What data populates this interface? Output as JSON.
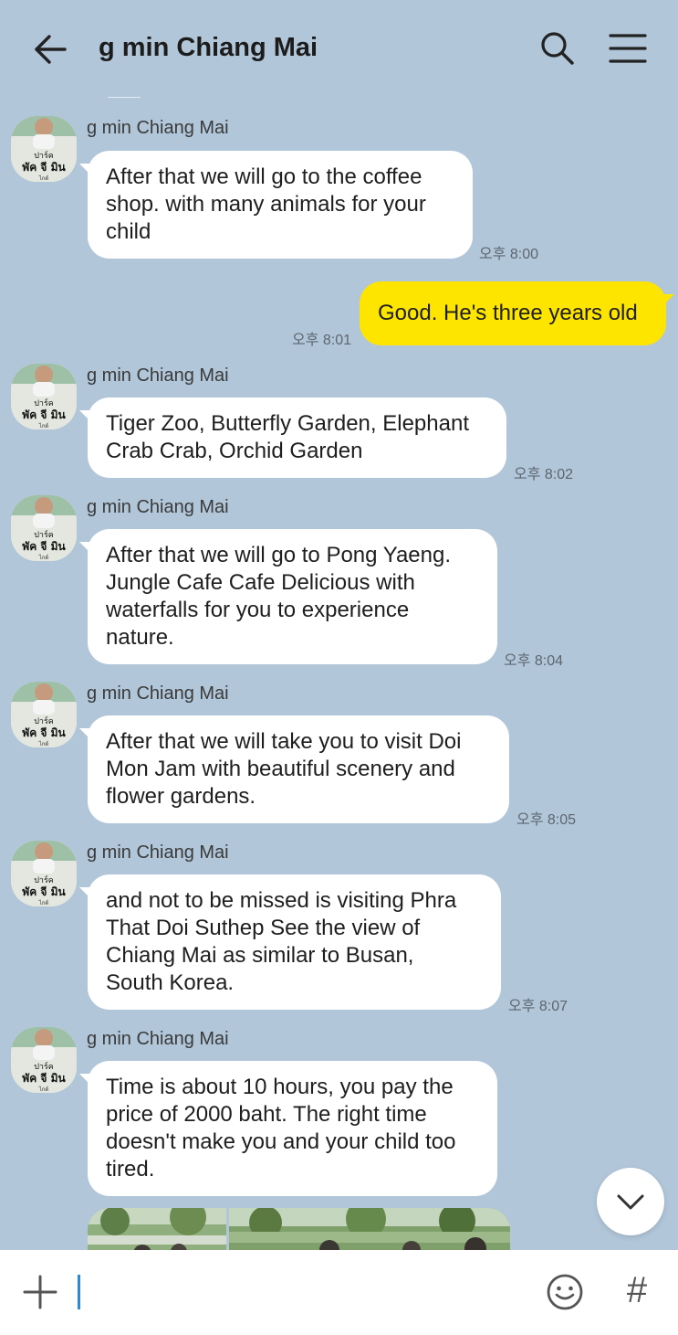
{
  "header": {
    "title": "g min  Chiang Mai"
  },
  "messages": [
    {
      "sender": "g min  Chiang Mai",
      "lines": [
        "After that we will go to the coffee",
        "shop. with many animals for your",
        "child"
      ],
      "time": "오후 8:00"
    },
    {
      "own_text": "Good. He's three years old",
      "time": "오후 8:01"
    },
    {
      "sender": "g min  Chiang Mai",
      "lines": [
        "Tiger Zoo, Butterfly Garden, Elephant",
        "Crab Crab, Orchid Garden"
      ],
      "time": "오후 8:02"
    },
    {
      "sender": "g min  Chiang Mai",
      "lines": [
        "After that we will go to Pong Yaeng.",
        "Jungle Cafe Cafe Delicious with",
        "waterfalls for you to experience",
        "nature."
      ],
      "time": "오후 8:04"
    },
    {
      "sender": "g min  Chiang Mai",
      "lines": [
        "After that we will take you to visit Doi",
        "Mon Jam with beautiful scenery and",
        "flower gardens."
      ],
      "time": "오후 8:05"
    },
    {
      "sender": "g min  Chiang Mai",
      "lines": [
        "and not to be missed is visiting Phra",
        "That Doi Suthep See the view of",
        "Chiang Mai as similar to Busan,",
        "South Korea."
      ],
      "time": "오후 8:07"
    },
    {
      "sender": "g min  Chiang Mai",
      "lines": [
        "Time is about 10 hours, you pay the",
        "price of 2000 baht. The right time",
        "doesn't make you and your child too",
        "tired."
      ]
    }
  ],
  "avatar_text": {
    "line1": "ปาร์ค",
    "line2": "พัค จี มิน",
    "line3": "ไกด์"
  },
  "input": {
    "hash_label": "#"
  },
  "colors": {
    "background": "#b1c6d9",
    "own_bubble": "#fee500",
    "other_bubble": "#ffffff",
    "cursor": "#2a8ad8"
  },
  "icons": [
    "back-arrow-icon",
    "search-icon",
    "menu-icon",
    "chevron-down-icon",
    "plus-icon",
    "emoji-icon"
  ]
}
